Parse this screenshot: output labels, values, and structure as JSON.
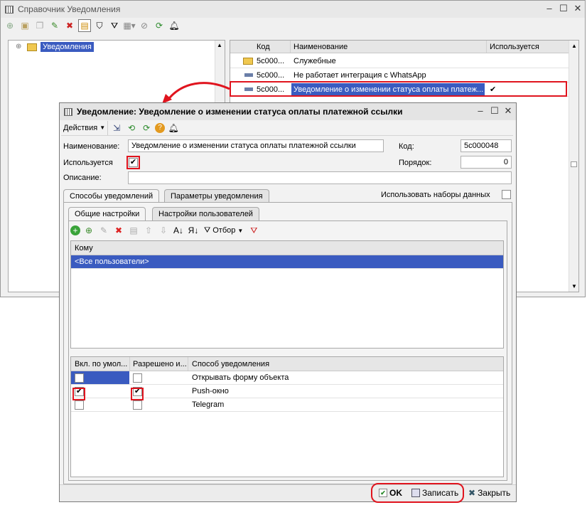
{
  "main_window": {
    "title": "Справочник Уведомления",
    "tree_root": "Уведомления",
    "columns": [
      "Код",
      "Наименование",
      "Используется"
    ],
    "rows": [
      {
        "code": "5c000...",
        "name": "Служебные",
        "used": ""
      },
      {
        "code": "5c000...",
        "name": "Не работает интеграция с WhatsApp",
        "used": ""
      },
      {
        "code": "5c000...",
        "name": "Уведомление о изменении статуса оплаты платеж...",
        "used": "✔"
      }
    ]
  },
  "dialog": {
    "title": "Уведомление: Уведомление о изменении статуса оплаты платежной ссылки",
    "actions_label": "Действия",
    "name_label": "Наименование:",
    "name_value": "Уведомление о изменении статуса оплаты платежной ссылки",
    "code_label": "Код:",
    "code_value": "5c000048",
    "used_label": "Используется",
    "used_checked": "✔",
    "order_label": "Порядок:",
    "order_value": "0",
    "desc_label": "Описание:",
    "desc_value": "",
    "tabs": [
      "Способы уведомлений",
      "Параметры уведомления"
    ],
    "use_datasets_label": "Использовать наборы данных",
    "subtabs": [
      "Общие настройки",
      "Настройки пользователей"
    ],
    "filter_label": "Отбор",
    "recipients_header": "Кому",
    "recipients": [
      "<Все пользователи>"
    ],
    "methods_columns": [
      "Вкл. по умол...",
      "Разрешено и...",
      "Способ уведомления"
    ],
    "methods": [
      {
        "default": "",
        "allowed": "",
        "name": "Открывать форму объекта"
      },
      {
        "default": "✔",
        "allowed": "✔",
        "name": "Push-окно"
      },
      {
        "default": "",
        "allowed": "",
        "name": "Telegram"
      }
    ],
    "ok_label": "OK",
    "save_label": "Записать",
    "close_label": "Закрыть"
  },
  "colors": {
    "accent": "#3a5bc0",
    "highlight": "#e0141e"
  }
}
